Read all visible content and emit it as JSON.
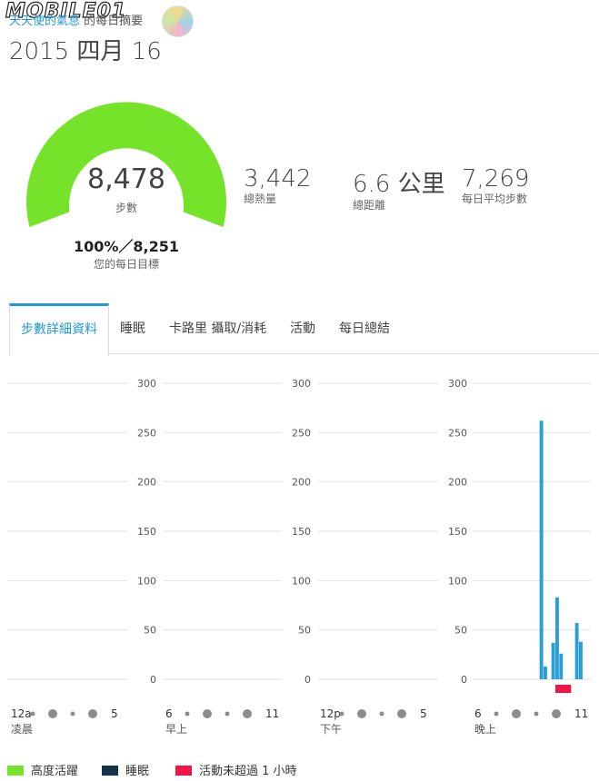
{
  "watermark": "MOBILE01",
  "header": {
    "user_name": "天天使的氣息",
    "suffix": "的每日摘要",
    "date_title": "2015 四月 16"
  },
  "gauge": {
    "value": "8,478",
    "label": "步數",
    "goal_value": "100%／8,251",
    "goal_label": "您的每日目標",
    "fill_fraction": 1.0,
    "color": "#76e32b"
  },
  "stats": [
    {
      "value": "3,442",
      "label": "總熱量"
    },
    {
      "value": "6.6 公里",
      "label": "總距離"
    },
    {
      "value": "7,269",
      "label": "每日平均步數"
    }
  ],
  "tabs": [
    {
      "label": "步數詳細資料",
      "active": true
    },
    {
      "label": "睡眠",
      "active": false
    },
    {
      "label": "卡路里 攝取/消耗",
      "active": false
    },
    {
      "label": "活動",
      "active": false
    },
    {
      "label": "每日總結",
      "active": false
    }
  ],
  "chart_data": {
    "type": "bar",
    "ylim": [
      0,
      300
    ],
    "y_ticks": [
      300,
      250,
      200,
      150,
      100,
      50,
      0
    ],
    "grid": true,
    "panels": [
      {
        "start_label": "12a",
        "end_label": "5",
        "period": "凌晨",
        "values": []
      },
      {
        "start_label": "6",
        "end_label": "11",
        "period": "早上",
        "values": []
      },
      {
        "start_label": "12p",
        "end_label": "5",
        "period": "下午",
        "values": []
      },
      {
        "start_label": "6",
        "end_label": "11",
        "period": "晚上",
        "values": [
          {
            "slot": 17,
            "value": 262
          },
          {
            "slot": 18,
            "value": 13
          },
          {
            "slot": 20,
            "value": 37
          },
          {
            "slot": 21,
            "value": 83
          },
          {
            "slot": 22,
            "value": 26
          },
          {
            "slot": 26,
            "value": 57
          },
          {
            "slot": 27,
            "value": 38
          }
        ],
        "inactive_marker": {
          "from_slot": 21,
          "to_slot": 25
        }
      }
    ],
    "colors": {
      "bar": "#2a9fd6",
      "inactive": "#ee1547",
      "grid": "#e2e2e2",
      "tick_text": "#555",
      "dot": "#8c8c8c"
    }
  },
  "legend": [
    {
      "label": "高度活躍",
      "color": "#76e32b"
    },
    {
      "label": "睡眠",
      "color": "#16324a"
    },
    {
      "label": "活動未超過 1 小時",
      "color": "#ee1547"
    }
  ]
}
